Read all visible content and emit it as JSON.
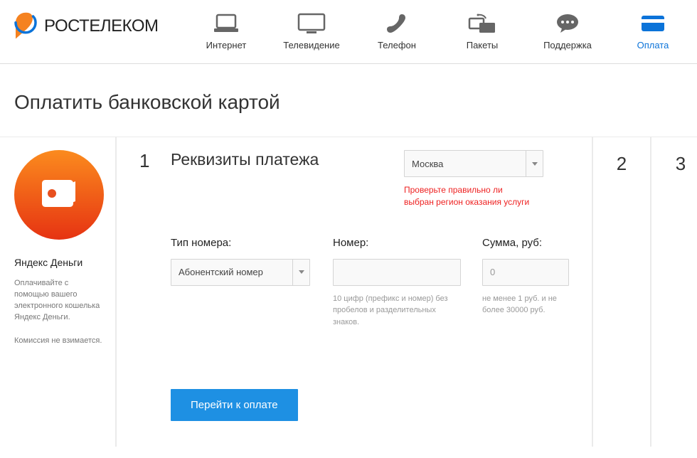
{
  "brand": {
    "name": "РОСТЕЛЕКОМ"
  },
  "nav": {
    "internet": "Интернет",
    "tv": "Телевидение",
    "phone": "Телефон",
    "packages": "Пакеты",
    "support": "Поддержка",
    "payment": "Оплата"
  },
  "page_title": "Оплатить банковской картой",
  "provider": {
    "name": "Яндекс Деньги",
    "desc": "Оплачивайте с помощью вашего электронного кошелька Яндекс Деньги.",
    "fee": "Комиссия не взимается."
  },
  "step": {
    "num": "1",
    "title": "Реквизиты платежа",
    "region_selected": "Москва",
    "warn_l1": "Проверьте правильно ли",
    "warn_l2": "выбран регион оказания услуги"
  },
  "form": {
    "type_label": "Тип номера:",
    "type_value": "Абонентский номер",
    "number_label": "Номер:",
    "number_hint": "10 цифр (префикс и номер) без пробелов и разделительных знаков.",
    "sum_label": "Сумма, руб:",
    "sum_placeholder": "0",
    "sum_hint": "не менее 1 руб. и не более 30000 руб."
  },
  "cta": "Перейти к оплате",
  "right_steps": {
    "s2": "2",
    "s3": "3"
  }
}
